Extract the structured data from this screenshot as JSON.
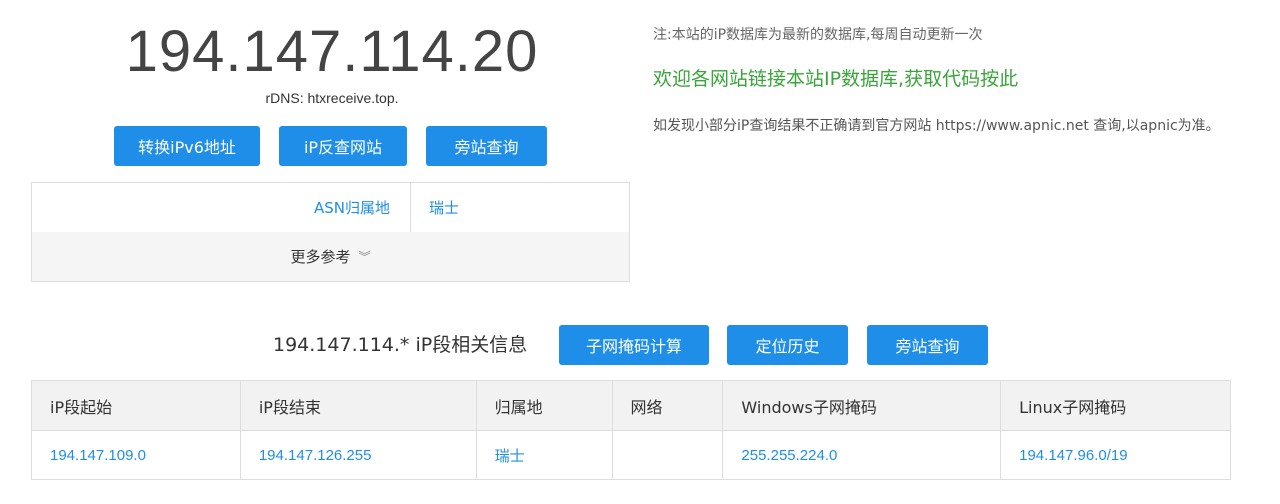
{
  "ip": {
    "address": "194.147.114.20",
    "rdns": "rDNS: htxreceive.top."
  },
  "buttons": {
    "ipv6": "转换iPv6地址",
    "reverse": "iP反查网站",
    "side": "旁站查询"
  },
  "asn": {
    "label": "ASN归属地",
    "value": "瑞士"
  },
  "more": {
    "label": "更多参考",
    "icon": "double-chevron-down-icon"
  },
  "notes": {
    "update": "注:本站的iP数据库为最新的数据库,每周自动更新一次",
    "welcome": "欢迎各网站链接本站IP数据库,获取代码按此",
    "info": "如发现小部分iP查询结果不正确请到官方网站 https://www.apnic.net 查询,以apnic为准。"
  },
  "segment": {
    "title": "194.147.114.* iP段相关信息",
    "buttons": {
      "mask": "子网掩码计算",
      "history": "定位历史",
      "side": "旁站查询"
    }
  },
  "table": {
    "headers": [
      "iP段起始",
      "iP段结束",
      "归属地",
      "网络",
      "Windows子网掩码",
      "Linux子网掩码"
    ],
    "rows": [
      [
        "194.147.109.0",
        "194.147.126.255",
        "瑞士",
        "",
        "255.255.224.0",
        "194.147.96.0/19"
      ]
    ]
  },
  "colors": {
    "accent": "#1e8ee8",
    "green": "#3aa53a"
  }
}
